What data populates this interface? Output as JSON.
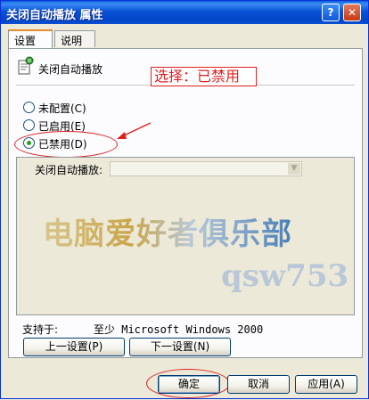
{
  "window": {
    "title": "关闭自动播放 属性",
    "help_glyph": "?",
    "close_glyph": "✕"
  },
  "tabs": [
    {
      "label": "设置",
      "selected": true
    },
    {
      "label": "说明",
      "selected": false
    }
  ],
  "policy": {
    "icon": "policy-setting-icon",
    "name": "关闭自动播放"
  },
  "radios": [
    {
      "label": "未配置(C)",
      "checked": false
    },
    {
      "label": "已启用(E)",
      "checked": false
    },
    {
      "label": "已禁用(D)",
      "checked": true
    }
  ],
  "annotation": {
    "text": "选择：已禁用"
  },
  "options": {
    "label": "关闭自动播放:",
    "value": "",
    "dropdown_glyph": "▼"
  },
  "watermark": {
    "line1": "电脑爱好者俱乐部",
    "line2": "qsw753"
  },
  "support": {
    "label": "支持于:",
    "value": "至少 Microsoft Windows 2000"
  },
  "nav": {
    "prev_label": "上一设置(P)",
    "next_label": "下一设置(N)"
  },
  "footer": {
    "ok_label": "确定",
    "cancel_label": "取消",
    "apply_label": "应用(A)"
  },
  "colors": {
    "titlebar": "#0a53d6",
    "annotation": "#e02020",
    "radio_checked": "#21a121"
  }
}
